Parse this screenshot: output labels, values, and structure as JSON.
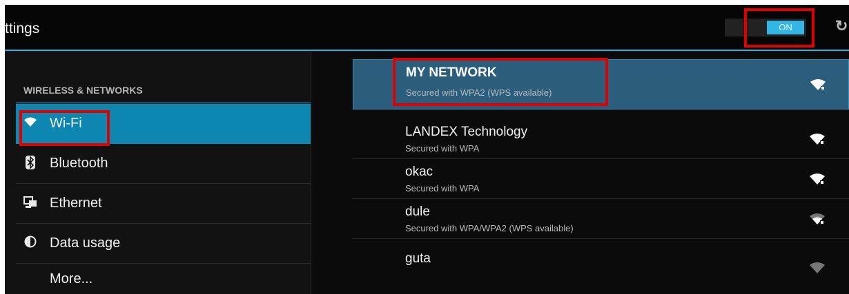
{
  "header": {
    "title": "ttings",
    "wifi_toggle": "ON"
  },
  "sidebar": {
    "section": "WIRELESS & NETWORKS",
    "items": [
      {
        "label": "Wi-Fi",
        "icon": "wifi-icon",
        "active": true
      },
      {
        "label": "Bluetooth",
        "icon": "bluetooth-icon",
        "active": false
      },
      {
        "label": "Ethernet",
        "icon": "ethernet-icon",
        "active": false
      },
      {
        "label": "Data usage",
        "icon": "data-usage-icon",
        "active": false
      },
      {
        "label": "More...",
        "icon": "",
        "active": false
      }
    ]
  },
  "networks": [
    {
      "name": "MY NETWORK",
      "security": "Secured with WPA2 (WPS available)",
      "selected": true
    },
    {
      "name": "LANDEX Technology",
      "security": "Secured with WPA",
      "selected": false
    },
    {
      "name": "okac",
      "security": "Secured with WPA",
      "selected": false
    },
    {
      "name": "dule",
      "security": "Secured with WPA/WPA2 (WPS available)",
      "selected": false
    },
    {
      "name": "guta",
      "security": "",
      "selected": false
    }
  ],
  "colors": {
    "accent": "#33b5e5",
    "selected_sidebar": "#0e86b2",
    "selected_network": "#2a5e7c",
    "highlight_box": "#e00000"
  }
}
